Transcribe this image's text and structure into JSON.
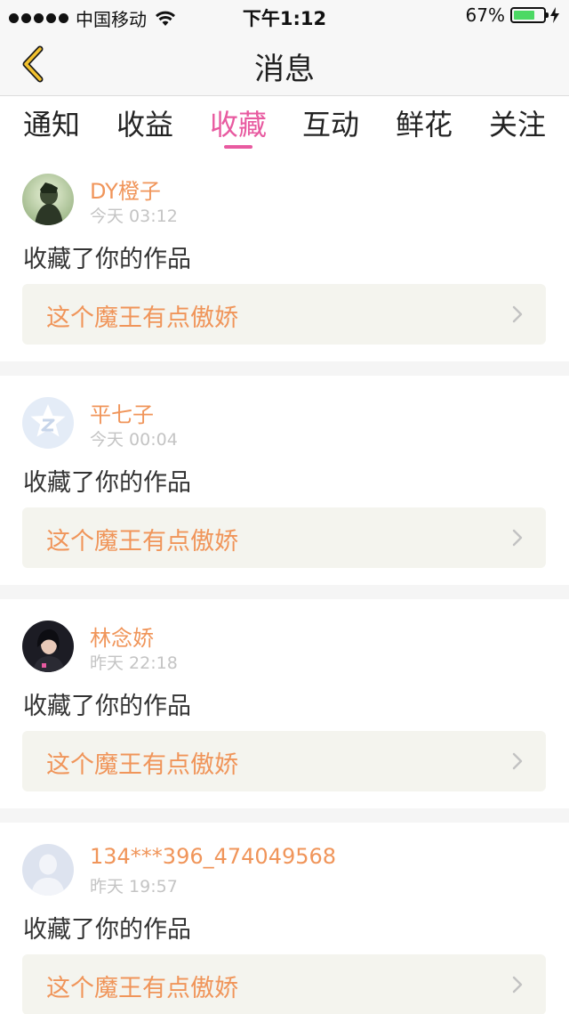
{
  "status_bar": {
    "carrier": "中国移动",
    "time": "下午1:12",
    "battery": "67%"
  },
  "nav": {
    "title": "消息"
  },
  "tabs": [
    {
      "label": "通知",
      "active": false
    },
    {
      "label": "收益",
      "active": false
    },
    {
      "label": "收藏",
      "active": true
    },
    {
      "label": "互动",
      "active": false
    },
    {
      "label": "鲜花",
      "active": false
    },
    {
      "label": "关注",
      "active": false
    }
  ],
  "colors": {
    "accent": "#e85aa0",
    "name_orange": "#f0955a",
    "box_bg": "#f4f4ee"
  },
  "messages": [
    {
      "username": "DY橙子",
      "time": "今天 03:12",
      "action": "收藏了你的作品",
      "work": "这个魔王有点傲娇",
      "avatar": "avatar-photo-boy"
    },
    {
      "username": "平七子",
      "time": "今天 00:04",
      "action": "收藏了你的作品",
      "work": "这个魔王有点傲娇",
      "avatar": "qq-default-avatar"
    },
    {
      "username": "林念娇",
      "time": "昨天 22:18",
      "action": "收藏了你的作品",
      "work": "这个魔王有点傲娇",
      "avatar": "avatar-photo-girl"
    },
    {
      "username": "134***396_474049568",
      "time": "昨天 19:57",
      "action": "收藏了你的作品",
      "work": "这个魔王有点傲娇",
      "avatar": "default-person-avatar"
    }
  ]
}
